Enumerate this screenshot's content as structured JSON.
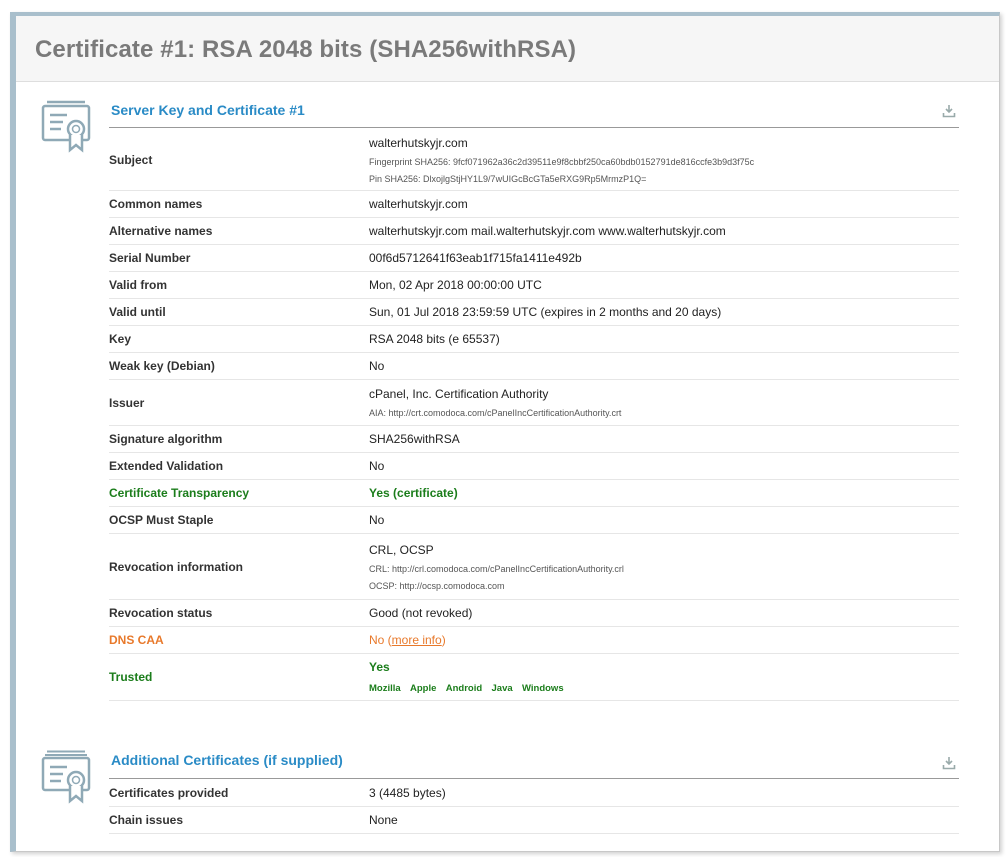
{
  "page_title": "Certificate #1: RSA 2048 bits (SHA256withRSA)",
  "section1": {
    "title": "Server Key and Certificate #1",
    "icon": "certificate-icon",
    "download_icon": "download-icon"
  },
  "subject": {
    "label": "Subject",
    "value": "walterhutskyjr.com",
    "fingerprint": "Fingerprint SHA256: 9fcf071962a36c2d39511e9f8cbbf250ca60bdb0152791de816ccfe3b9d3f75c",
    "pin": "Pin SHA256: DlxojlgStjHY1L9/7wUIGcBcGTa5eRXG9Rp5MrmzP1Q="
  },
  "common_names": {
    "label": "Common names",
    "value": "walterhutskyjr.com"
  },
  "alt_names": {
    "label": "Alternative names",
    "value": "walterhutskyjr.com mail.walterhutskyjr.com www.walterhutskyjr.com"
  },
  "serial": {
    "label": "Serial Number",
    "value": "00f6d5712641f63eab1f715fa1411e492b"
  },
  "valid_from": {
    "label": "Valid from",
    "value": "Mon, 02 Apr 2018 00:00:00 UTC"
  },
  "valid_until": {
    "label": "Valid until",
    "value": "Sun, 01 Jul 2018 23:59:59 UTC (expires in 2 months and 20 days)"
  },
  "key": {
    "label": "Key",
    "value": "RSA 2048 bits (e 65537)"
  },
  "weak_key": {
    "label": "Weak key (Debian)",
    "value": "No"
  },
  "issuer": {
    "label": "Issuer",
    "value": "cPanel, Inc. Certification Authority",
    "aia": "AIA: http://crt.comodoca.com/cPanelIncCertificationAuthority.crt"
  },
  "sig_alg": {
    "label": "Signature algorithm",
    "value": "SHA256withRSA"
  },
  "ev": {
    "label": "Extended Validation",
    "value": "No"
  },
  "ct": {
    "label": "Certificate Transparency",
    "value": "Yes (certificate)"
  },
  "ocsp_staple": {
    "label": "OCSP Must Staple",
    "value": "No"
  },
  "revocation_info": {
    "label": "Revocation information",
    "value": "CRL, OCSP",
    "crl": "CRL: http://crl.comodoca.com/cPanelIncCertificationAuthority.crl",
    "ocsp": "OCSP: http://ocsp.comodoca.com"
  },
  "revocation_status": {
    "label": "Revocation status",
    "value": "Good (not revoked)"
  },
  "dns_caa": {
    "label": "DNS CAA",
    "value_prefix": "No (",
    "link": "more info",
    "value_suffix": ")"
  },
  "trusted": {
    "label": "Trusted",
    "value": "Yes",
    "stores": [
      "Mozilla",
      "Apple",
      "Android",
      "Java",
      "Windows"
    ]
  },
  "section2": {
    "title": "Additional Certificates (if supplied)",
    "icon": "certificate-icon",
    "download_icon": "download-icon"
  },
  "certs_provided": {
    "label": "Certificates provided",
    "value": "3 (4485 bytes)"
  },
  "chain_issues": {
    "label": "Chain issues",
    "value": "None"
  },
  "colors": {
    "accent_blue": "#2a8bc6",
    "green": "#1b7d1b",
    "orange": "#e8792b",
    "title_gray": "#7a7a7a"
  }
}
